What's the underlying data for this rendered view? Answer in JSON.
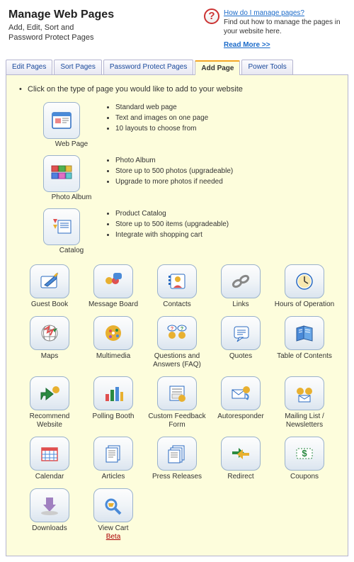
{
  "header": {
    "title": "Manage Web Pages",
    "subtitle_line1": "Add, Edit, Sort and",
    "subtitle_line2": "Password Protect Pages"
  },
  "help": {
    "title": "How do I manage pages?",
    "text": "Find out how to manage the pages in your website here.",
    "read_more": "Read More >>"
  },
  "tabs": [
    {
      "label": "Edit Pages",
      "active": false
    },
    {
      "label": "Sort Pages",
      "active": false
    },
    {
      "label": "Password Protect Pages",
      "active": false
    },
    {
      "label": "Add Page",
      "active": true
    },
    {
      "label": "Power Tools",
      "active": false
    }
  ],
  "instruction": "Click on the type of page you would like to add to your website",
  "featured": [
    {
      "name": "Web Page",
      "icon": "web-page",
      "bullets": [
        "Standard web page",
        "Text and images on one page",
        "10 layouts to choose from"
      ]
    },
    {
      "name": "Photo Album",
      "icon": "photo-album",
      "bullets": [
        "Photo Album",
        "Store up to 500 photos (upgradeable)",
        "Upgrade to more photos if needed"
      ]
    },
    {
      "name": "Catalog",
      "icon": "catalog",
      "bullets": [
        "Product Catalog",
        "Store up to 500 items (upgradeable)",
        "Integrate with shopping cart"
      ]
    }
  ],
  "grid": [
    {
      "label": "Guest Book",
      "icon": "guest-book"
    },
    {
      "label": "Message Board",
      "icon": "message-board"
    },
    {
      "label": "Contacts",
      "icon": "contacts"
    },
    {
      "label": "Links",
      "icon": "links"
    },
    {
      "label": "Hours of Operation",
      "icon": "hours"
    },
    {
      "label": "Maps",
      "icon": "maps"
    },
    {
      "label": "Multimedia",
      "icon": "multimedia"
    },
    {
      "label": "Questions and Answers (FAQ)",
      "icon": "faq"
    },
    {
      "label": "Quotes",
      "icon": "quotes"
    },
    {
      "label": "Table of Contents",
      "icon": "toc"
    },
    {
      "label": "Recommend Website",
      "icon": "recommend"
    },
    {
      "label": "Polling Booth",
      "icon": "polling"
    },
    {
      "label": "Custom Feedback Form",
      "icon": "feedback"
    },
    {
      "label": "Autoresponder",
      "icon": "autoresponder"
    },
    {
      "label": "Mailing List / Newsletters",
      "icon": "mailing"
    },
    {
      "label": "Calendar",
      "icon": "calendar"
    },
    {
      "label": "Articles",
      "icon": "articles"
    },
    {
      "label": "Press Releases",
      "icon": "press"
    },
    {
      "label": "Redirect",
      "icon": "redirect"
    },
    {
      "label": "Coupons",
      "icon": "coupons"
    },
    {
      "label": "Downloads",
      "icon": "downloads"
    },
    {
      "label": "View Cart",
      "icon": "view-cart",
      "beta": "Beta"
    }
  ]
}
